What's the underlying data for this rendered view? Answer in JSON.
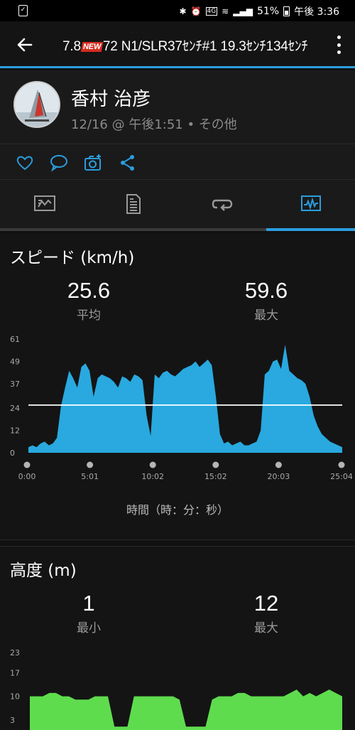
{
  "status_bar": {
    "battery": "51%",
    "time": "午後 3:36",
    "lte_label": "4G"
  },
  "header": {
    "title_prefix": "7.8",
    "title_badge": "NEW",
    "title_suffix": "72 N1/SLR37ｾﾝﾁ#1  19.3ｾﾝﾁ134ｾﾝﾁ"
  },
  "profile": {
    "name": "香村 治彦",
    "meta": "12/16 @ 午後1:51 • その他"
  },
  "colors": {
    "accent": "#2b9dde",
    "speed_fill": "#29a9df",
    "altitude_fill": "#5fdc4e"
  },
  "speed": {
    "title": "スピード (km/h)",
    "avg_value": "25.6",
    "avg_label": "平均",
    "max_value": "59.6",
    "max_label": "最大",
    "x_axis_title": "時間（時：分：秒）"
  },
  "altitude": {
    "title": "高度 (m)",
    "min_value": "1",
    "min_label": "最小",
    "max_value": "12",
    "max_label": "最大"
  },
  "chart_data": [
    {
      "type": "area",
      "series": [
        {
          "values": [
            3,
            4,
            3,
            5,
            6,
            4,
            5,
            8,
            25,
            35,
            44,
            40,
            35,
            46,
            48,
            44,
            30,
            40,
            42,
            41,
            40,
            38,
            35,
            41,
            40,
            38,
            42,
            41,
            39,
            20,
            9,
            42,
            40,
            43,
            44,
            42,
            41,
            43,
            45,
            46,
            47,
            49,
            46,
            48,
            50,
            47,
            30,
            10,
            5,
            6,
            4,
            5,
            6,
            4,
            4,
            5,
            6,
            12,
            42,
            44,
            49,
            50,
            45,
            58,
            44,
            42,
            40,
            39,
            37,
            30,
            20,
            14,
            10,
            8,
            6,
            5,
            4,
            3
          ]
        }
      ],
      "x_ticks": [
        "0:00",
        "5:01",
        "10:02",
        "15:02",
        "20:03",
        "25:04"
      ],
      "y_ticks": [
        "0",
        "12",
        "24",
        "37",
        "49",
        "61"
      ],
      "ylim": [
        0,
        61
      ],
      "average_line": 25.6,
      "xlabel": "時間（時：分：秒）",
      "ylabel": "",
      "title": "スピード (km/h)",
      "grid": false
    },
    {
      "type": "area",
      "series": [
        {
          "values": [
            10,
            10,
            10,
            11,
            11,
            10,
            10,
            9,
            9,
            9,
            10,
            10,
            10,
            1,
            1,
            1,
            10,
            10,
            10,
            10,
            10,
            10,
            10,
            9,
            1,
            1,
            1,
            1,
            9,
            10,
            10,
            10,
            11,
            11,
            10,
            10,
            10,
            10,
            10,
            10,
            11,
            12,
            10,
            11,
            10,
            11,
            12,
            11,
            10
          ]
        }
      ],
      "y_ticks": [
        "3",
        "10",
        "17",
        "23"
      ],
      "ylim": [
        0,
        23
      ],
      "title": "高度 (m)",
      "xlabel": "",
      "ylabel": "",
      "grid": false
    }
  ]
}
